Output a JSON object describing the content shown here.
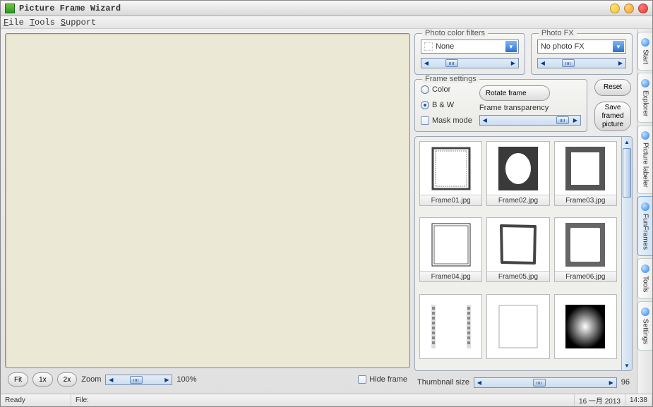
{
  "window": {
    "title": "Picture Frame Wizard"
  },
  "menu": {
    "file": "File",
    "tools": "Tools",
    "support": "Support"
  },
  "zoom": {
    "fit": "Fit",
    "x1": "1x",
    "x2": "2x",
    "label": "Zoom",
    "value": "100%"
  },
  "hide_frame": "Hide frame",
  "filters": {
    "title": "Photo color filters",
    "selected": "None"
  },
  "fx": {
    "title": "Photo FX",
    "selected": "No photo FX"
  },
  "frame_settings": {
    "title": "Frame settings",
    "color": "Color",
    "bw": "B & W",
    "mask": "Mask mode",
    "rotate": "Rotate frame",
    "transparency": "Frame transparency"
  },
  "buttons": {
    "reset": "Reset",
    "save": "Save framed picture"
  },
  "thumb_size": {
    "label": "Thumbnail size",
    "value": "96"
  },
  "frames": [
    "Frame01.jpg",
    "Frame02.jpg",
    "Frame03.jpg",
    "Frame04.jpg",
    "Frame05.jpg",
    "Frame06.jpg",
    "",
    "",
    ""
  ],
  "side_tabs": {
    "start": "Start",
    "explorer": "Explorer",
    "labeler": "Picture labeler",
    "fun": "FunFrames",
    "tools": "Tools",
    "settings": "Settings"
  },
  "status": {
    "ready": "Ready",
    "file": "File:",
    "date": "16 一月 2013",
    "time": "14:38"
  }
}
